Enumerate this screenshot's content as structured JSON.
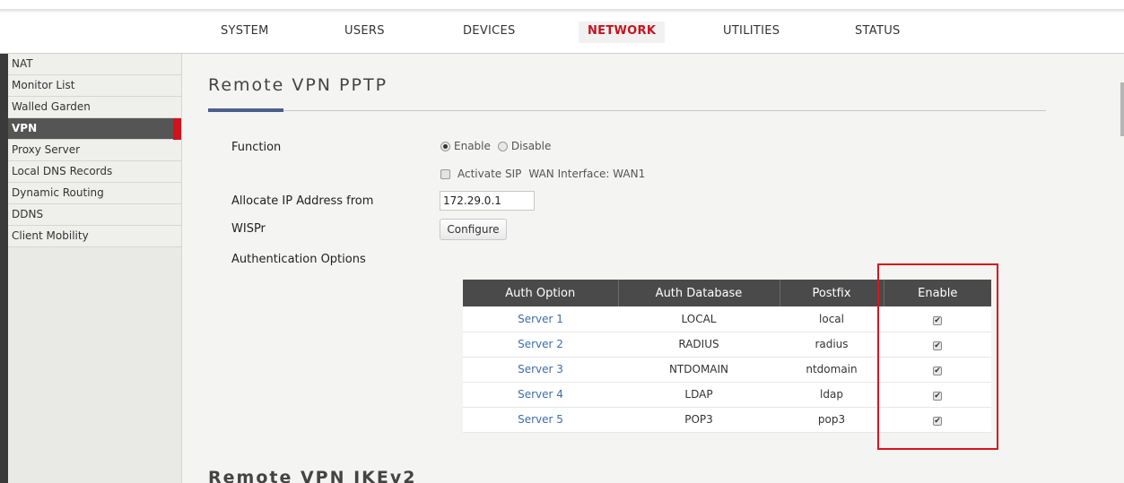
{
  "nav": {
    "tabs": [
      "SYSTEM",
      "USERS",
      "DEVICES",
      "NETWORK",
      "UTILITIES",
      "STATUS"
    ],
    "active": "NETWORK"
  },
  "sidebar": {
    "items": [
      "NAT",
      "Monitor List",
      "Walled Garden",
      "VPN",
      "Proxy Server",
      "Local DNS Records",
      "Dynamic Routing",
      "DDNS",
      "Client Mobility"
    ],
    "active": "VPN"
  },
  "page": {
    "title": "Remote VPN  PPTP",
    "section2_title": "Remote VPN  IKEv2"
  },
  "form": {
    "function_label": "Function",
    "enable_label": "Enable",
    "disable_label": "Disable",
    "function_value": "Enable",
    "sip_label": "Activate SIP",
    "wan_text": "WAN Interface: WAN1",
    "ip_label": "Allocate IP Address from",
    "ip_value": "172.29.0.1",
    "wispr_label": "WISPr",
    "configure_label": "Configure",
    "auth_label": "Authentication Options"
  },
  "auth_table": {
    "headers": [
      "Auth Option",
      "Auth Database",
      "Postfix",
      "Enable"
    ],
    "rows": [
      {
        "option": "Server 1",
        "database": "LOCAL",
        "postfix": "local",
        "enabled": "✔"
      },
      {
        "option": "Server 2",
        "database": "RADIUS",
        "postfix": "radius",
        "enabled": "✔"
      },
      {
        "option": "Server 3",
        "database": "NTDOMAIN",
        "postfix": "ntdomain",
        "enabled": "✔"
      },
      {
        "option": "Server 4",
        "database": "LDAP",
        "postfix": "ldap",
        "enabled": "✔"
      },
      {
        "option": "Server 5",
        "database": "POP3",
        "postfix": "pop3",
        "enabled": "✔"
      }
    ]
  },
  "colors": {
    "accent_red": "#d0121c",
    "link_blue": "#3d6ea8",
    "header_dark": "#4a4a4a",
    "title_accent": "#4b5f8d"
  }
}
